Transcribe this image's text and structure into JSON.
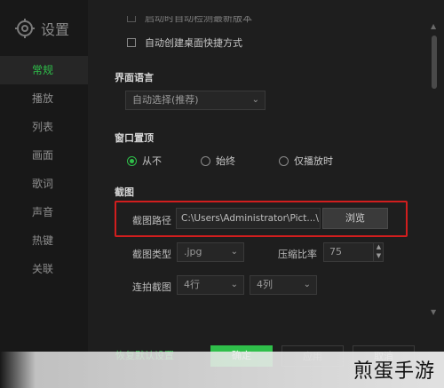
{
  "sidebar": {
    "title": "设置",
    "items": [
      {
        "label": "常规",
        "active": true
      },
      {
        "label": "播放"
      },
      {
        "label": "列表"
      },
      {
        "label": "画面"
      },
      {
        "label": "歌词"
      },
      {
        "label": "声音"
      },
      {
        "label": "热键"
      },
      {
        "label": "关联"
      }
    ]
  },
  "general": {
    "startup_checkbox_label": "启动时自动检测最新版本",
    "desktop_shortcut_label": "自动创建桌面快捷方式",
    "language": {
      "title": "界面语言",
      "selected": "自动选择(推荐)"
    },
    "topmost": {
      "title": "窗口置顶",
      "options": [
        "从不",
        "始终",
        "仅播放时"
      ],
      "selected_index": 0
    },
    "screenshot": {
      "title": "截图",
      "path_label": "截图路径",
      "path_value": "C:\\Users\\Administrator\\Pict...\\",
      "browse_label": "浏览",
      "type_label": "截图类型",
      "type_value": ".jpg",
      "ratio_label": "压缩比率",
      "ratio_value": "75",
      "burst_label": "连拍截图",
      "rows_value": "4行",
      "cols_value": "4列"
    }
  },
  "footer": {
    "restore_label": "恢复默认设置",
    "ok_label": "确定",
    "apply_label": "应用",
    "cancel_label": "取消"
  },
  "watermark": "煎蛋手游",
  "colors": {
    "accent": "#2fbf4a",
    "highlight": "#d11e1e"
  }
}
